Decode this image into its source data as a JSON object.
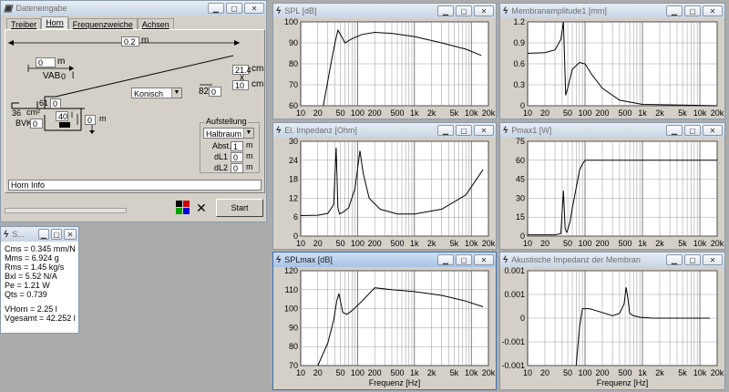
{
  "dateneingabe": {
    "title": "Dateneingabe",
    "tabs": [
      "Treiber",
      "Horn",
      "Frequenzweiche",
      "Achsen"
    ],
    "length_value": "0.2",
    "length_unit": "m",
    "x_value": "0",
    "x_unit": "m",
    "vab_label": "VAB",
    "vab_value": "0",
    "vab_unit": "l",
    "field_61": "61",
    "field_0a": "0",
    "shape_select": "Konisch",
    "field_82_label": "82",
    "field_82_value": "0",
    "dim_w": "21.4",
    "dim_unit1": "cm",
    "dim_x": "x",
    "dim_h": "10",
    "dim_unit2": "cm",
    "field_36": "36",
    "field_36_unit": "cm²",
    "bvk_label": "BVK",
    "bvk_value": "0",
    "field_40": "40",
    "field_40_unit": "l",
    "offset_value": "0",
    "offset_unit": "m",
    "aufstellung_title": "Aufstellung",
    "aufstellung_select": "Halbraum",
    "abst_label": "Abst.",
    "abst_value": "1",
    "abst_unit": "m",
    "dl1_label": "dL1",
    "dl1_value": "0",
    "dl1_unit": "m",
    "dl2_label": "dL2",
    "dl2_value": "0",
    "dl2_unit": "m",
    "horn_info": "Horn Info",
    "start_label": "Start",
    "colors": [
      "#000000",
      "#d40000",
      "#00a000",
      "#0000d4"
    ]
  },
  "params": {
    "title": "S...",
    "lines": [
      "Cms = 0.345 mm/N",
      "Mms = 6.924 g",
      "Rms = 1.45 kg/s",
      "Bxl = 5.52 N/A",
      "Pe = 1.21 W",
      "Qts = 0.739",
      "",
      "VHorn = 2.25 l",
      "Vgesamt = 42.252 l"
    ]
  },
  "charts": {
    "spl": {
      "title": "SPL [dB]",
      "xlabel": "",
      "ylim": [
        60,
        100
      ],
      "yticks": [
        "100",
        "90",
        "80",
        "70",
        "60"
      ]
    },
    "membran": {
      "title": "Membranamplitude1 [mm]",
      "xlabel": "",
      "ylim": [
        0,
        1.2
      ],
      "yticks": [
        "1.2",
        "0.9",
        "0.6",
        "0.3",
        "0"
      ]
    },
    "impedanz": {
      "title": "El. Impedanz [Ohm]",
      "xlabel": "",
      "ylim": [
        0,
        30
      ],
      "yticks": [
        "30",
        "24",
        "18",
        "12",
        "6",
        "0"
      ]
    },
    "pmax": {
      "title": "Pmax1 [W]",
      "xlabel": "",
      "ylim": [
        0,
        75
      ],
      "yticks": [
        "75",
        "60",
        "45",
        "30",
        "15",
        "0"
      ]
    },
    "splmax": {
      "title": "SPLmax [dB]",
      "xlabel": "Frequenz [Hz]",
      "ylim": [
        70,
        120
      ],
      "yticks": [
        "120",
        "110",
        "100",
        "90",
        "80",
        "70"
      ]
    },
    "akustisch": {
      "title": "Akustische Impedanz der Membran",
      "xlabel": "Frequenz [Hz]",
      "ylim": [
        -0.001,
        0.001
      ],
      "yticks": [
        "0.001",
        "0.001",
        "0",
        "-0.001",
        "-0.001"
      ]
    },
    "xticks": [
      "10",
      "20",
      "50",
      "100",
      "200",
      "500",
      "1k",
      "2k",
      "5k",
      "10k",
      "20k"
    ]
  },
  "chart_data": [
    {
      "type": "line",
      "title": "SPL [dB]",
      "xscale": "log",
      "xlim": [
        10,
        20000
      ],
      "ylim": [
        60,
        100
      ],
      "series": [
        {
          "x": [
            25,
            30,
            35,
            40,
            45,
            50,
            60,
            80,
            120,
            200,
            400,
            1000,
            3000,
            8000,
            15000
          ],
          "values": [
            60,
            72,
            82,
            90,
            96,
            94,
            90,
            92,
            94,
            95,
            94.5,
            93,
            90,
            87,
            84
          ]
        }
      ]
    },
    {
      "type": "line",
      "title": "Membranamplitude1 [mm]",
      "xscale": "log",
      "xlim": [
        10,
        20000
      ],
      "ylim": [
        0,
        1.2
      ],
      "series": [
        {
          "x": [
            10,
            20,
            30,
            38,
            42,
            44,
            46,
            50,
            60,
            80,
            100,
            130,
            200,
            400,
            1000,
            20000
          ],
          "values": [
            0.75,
            0.76,
            0.8,
            0.95,
            1.2,
            0.7,
            0.15,
            0.25,
            0.52,
            0.62,
            0.6,
            0.45,
            0.25,
            0.08,
            0.02,
            0.0
          ]
        }
      ]
    },
    {
      "type": "line",
      "title": "El. Impedanz [Ohm]",
      "xscale": "log",
      "xlim": [
        10,
        20000
      ],
      "ylim": [
        0,
        30
      ],
      "series": [
        {
          "x": [
            10,
            20,
            30,
            38,
            42,
            45,
            48,
            55,
            70,
            90,
            110,
            125,
            160,
            250,
            500,
            1000,
            3000,
            8000,
            16000
          ],
          "values": [
            6.5,
            6.6,
            7.2,
            10,
            28,
            9,
            7,
            7.5,
            9,
            15,
            27,
            20,
            12,
            8.5,
            7,
            7,
            8.5,
            13,
            21
          ]
        }
      ]
    },
    {
      "type": "line",
      "title": "Pmax1 [W]",
      "xscale": "log",
      "xlim": [
        10,
        20000
      ],
      "ylim": [
        0,
        75
      ],
      "series": [
        {
          "x": [
            10,
            30,
            38,
            42,
            45,
            48,
            50,
            55,
            60,
            70,
            80,
            90,
            100,
            140,
            20000
          ],
          "values": [
            1,
            1,
            2,
            36,
            6,
            3,
            5,
            12,
            22,
            38,
            52,
            57,
            60,
            60,
            60
          ]
        }
      ]
    },
    {
      "type": "line",
      "title": "SPLmax [dB]",
      "xscale": "log",
      "xlim": [
        10,
        20000
      ],
      "ylim": [
        70,
        120
      ],
      "xlabel": "Frequenz [Hz]",
      "series": [
        {
          "x": [
            20,
            30,
            38,
            43,
            47,
            50,
            55,
            65,
            80,
            120,
            200,
            400,
            1000,
            3000,
            8000,
            16000
          ],
          "values": [
            70,
            82,
            94,
            104,
            108,
            104,
            98,
            97,
            99,
            104,
            111,
            110,
            109,
            107,
            104,
            101
          ]
        }
      ]
    },
    {
      "type": "line",
      "title": "Akustische Impedanz der Membran",
      "xscale": "log",
      "xlim": [
        10,
        20000
      ],
      "ylim": [
        -0.001,
        0.001
      ],
      "xlabel": "Frequenz [Hz]",
      "series": [
        {
          "x": [
            70,
            80,
            90,
            120,
            200,
            300,
            400,
            480,
            520,
            560,
            600,
            700,
            900,
            1500,
            3000,
            10000,
            15000
          ],
          "values": [
            -0.001,
            -0.0002,
            0.0002,
            0.0002,
            0.00012,
            5e-05,
            0.0001,
            0.0003,
            0.00065,
            0.0004,
            0.0001,
            5e-05,
            2e-05,
            0.0,
            0.0,
            0.0,
            0.0
          ]
        }
      ]
    }
  ]
}
